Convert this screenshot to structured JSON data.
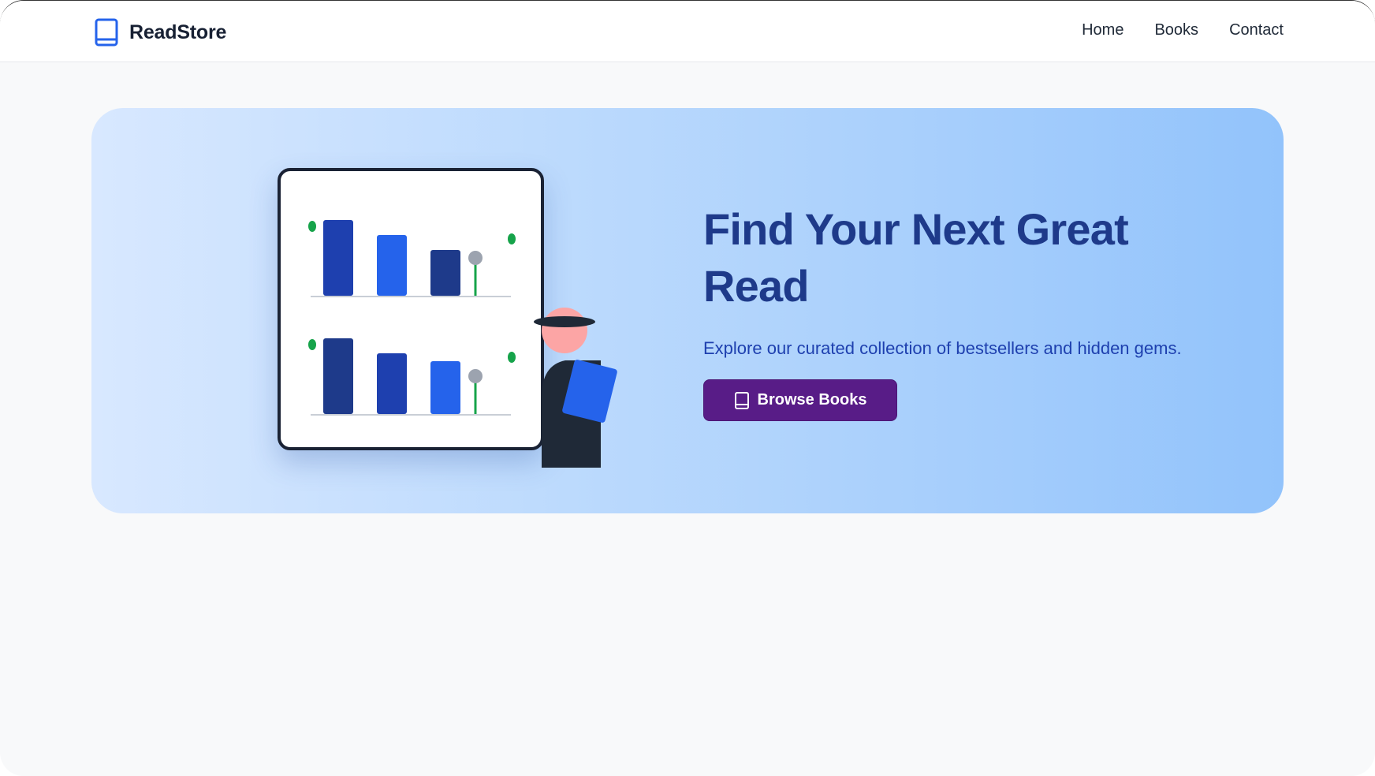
{
  "header": {
    "brand_name": "ReadStore",
    "brand_icon": "book-icon",
    "nav": [
      {
        "label": "Home"
      },
      {
        "label": "Books"
      },
      {
        "label": "Contact"
      }
    ]
  },
  "hero": {
    "title": "Find Your Next Great Read",
    "subtitle": "Explore our curated collection of bestsellers and hidden gems.",
    "cta_label": "Browse Books",
    "cta_icon": "book-icon"
  },
  "illustration": {
    "description_icon": "bookshelf-illustration",
    "colors": {
      "dark_blue": "#1e3a8a",
      "blue": "#1e40af",
      "bright_blue": "#2563eb",
      "green": "#16a34a",
      "gray": "#9ca3af",
      "skin": "#fca5a5",
      "dark": "#1f2937"
    }
  },
  "colors": {
    "brand_icon": "#2563eb",
    "cta_bg": "#581c87",
    "title": "#1e3a8a"
  }
}
